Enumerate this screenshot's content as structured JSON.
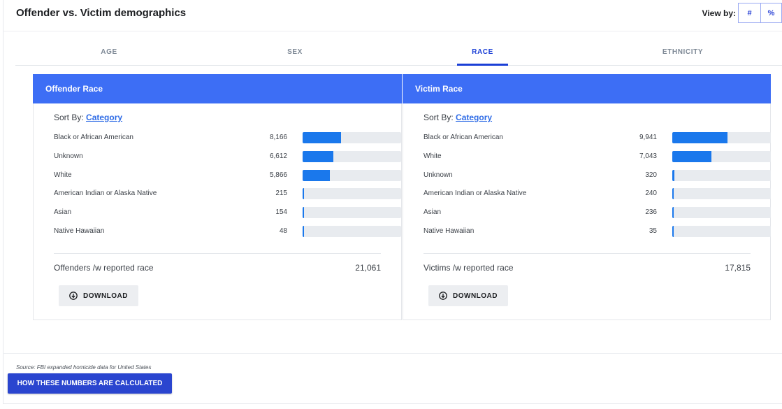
{
  "header": {
    "title": "Offender vs. Victim demographics",
    "view_by_label": "View by:",
    "view_by_options": [
      "#",
      "%"
    ]
  },
  "tabs": [
    {
      "label": "AGE",
      "active": false
    },
    {
      "label": "SEX",
      "active": false
    },
    {
      "label": "RACE",
      "active": true
    },
    {
      "label": "ETHNICITY",
      "active": false
    }
  ],
  "colors": {
    "panel_header": "#3d6ef5",
    "bar_fill": "#1a78ec",
    "bar_track": "#e8ebef",
    "active_tab": "#1b3fd6",
    "primary_button": "#2a45cf"
  },
  "panels": [
    {
      "title": "Offender Race",
      "sort_by_label": "Sort By:",
      "sort_by_link": "Category",
      "total_label": "Offenders /w reported race",
      "total_value": "21,061",
      "download_label": "DOWNLOAD"
    },
    {
      "title": "Victim Race",
      "sort_by_label": "Sort By:",
      "sort_by_link": "Category",
      "total_label": "Victims /w reported race",
      "total_value": "17,815",
      "download_label": "DOWNLOAD"
    }
  ],
  "chart_data": [
    {
      "type": "bar",
      "title": "Offender Race",
      "categories": [
        "Black or African American",
        "Unknown",
        "White",
        "American Indian or Alaska Native",
        "Asian",
        "Native Hawaiian"
      ],
      "values": [
        8166,
        6612,
        5866,
        215,
        154,
        48
      ],
      "value_labels": [
        "8,166",
        "6,612",
        "5,866",
        "215",
        "154",
        "48"
      ],
      "total": 21061
    },
    {
      "type": "bar",
      "title": "Victim Race",
      "categories": [
        "Black or African American",
        "White",
        "Unknown",
        "American Indian or Alaska Native",
        "Asian",
        "Native Hawaiian"
      ],
      "values": [
        9941,
        7043,
        320,
        240,
        236,
        35
      ],
      "value_labels": [
        "9,941",
        "7,043",
        "320",
        "240",
        "236",
        "35"
      ],
      "total": 17815
    }
  ],
  "footer": {
    "source": "Source: FBI expanded homicide data for United States",
    "calc_button": "HOW THESE NUMBERS ARE CALCULATED"
  }
}
